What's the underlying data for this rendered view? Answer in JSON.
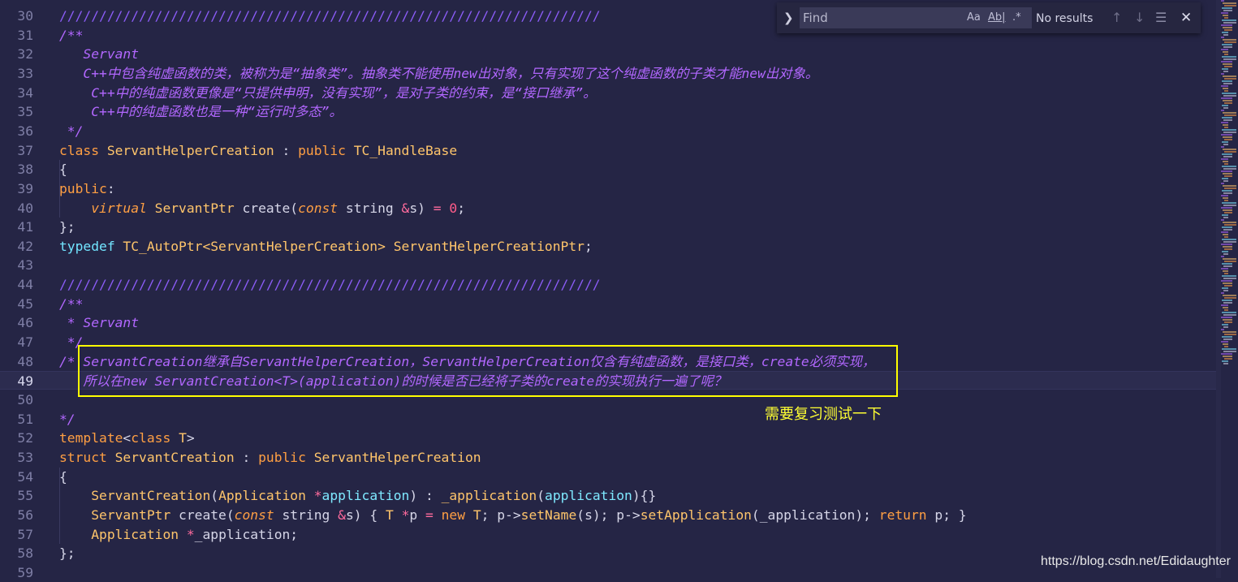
{
  "editor": {
    "lines": [
      {
        "n": "30",
        "tokens": [
          {
            "c": "t-sep",
            "t": "////////////////////////////////////////////////////////////////////"
          }
        ]
      },
      {
        "n": "31",
        "tokens": [
          {
            "c": "t-comment",
            "t": "/**"
          }
        ]
      },
      {
        "n": "32",
        "tokens": [
          {
            "c": "t-comment",
            "t": "   Servant"
          }
        ]
      },
      {
        "n": "33",
        "tokens": [
          {
            "c": "t-comment",
            "t": "   C++中包含纯虚函数的类，被称为是“抽象类”。抽象类不能使用new出对象，只有实现了这个纯虚函数的子类才能new出对象。"
          }
        ]
      },
      {
        "n": "34",
        "tokens": [
          {
            "c": "t-comment",
            "t": "    C++中的纯虚函数更像是“只提供申明，没有实现”，是对子类的约束，是“接口继承”。"
          }
        ]
      },
      {
        "n": "35",
        "tokens": [
          {
            "c": "t-comment",
            "t": "    C++中的纯虚函数也是一种“运行时多态”。"
          }
        ]
      },
      {
        "n": "36",
        "tokens": [
          {
            "c": "t-comment",
            "t": " */"
          }
        ]
      },
      {
        "n": "37",
        "tokens": [
          {
            "c": "t-kw",
            "t": "class "
          },
          {
            "c": "t-type",
            "t": "ServantHelperCreation"
          },
          {
            "c": "t-plain",
            "t": " : "
          },
          {
            "c": "t-kw",
            "t": "public "
          },
          {
            "c": "t-type",
            "t": "TC_HandleBase"
          }
        ]
      },
      {
        "n": "38",
        "tokens": [
          {
            "c": "t-plain",
            "t": "{"
          }
        ]
      },
      {
        "n": "39",
        "tokens": [
          {
            "c": "t-kw",
            "t": "public"
          },
          {
            "c": "t-plain",
            "t": ":"
          }
        ]
      },
      {
        "n": "40",
        "tokens": [
          {
            "c": "t-plain",
            "t": "    "
          },
          {
            "c": "t-italic",
            "t": "virtual "
          },
          {
            "c": "t-type",
            "t": "ServantPtr "
          },
          {
            "c": "t-plain",
            "t": "create("
          },
          {
            "c": "t-italic",
            "t": "const "
          },
          {
            "c": "t-plain",
            "t": "string "
          },
          {
            "c": "t-op",
            "t": "&"
          },
          {
            "c": "t-plain",
            "t": "s) "
          },
          {
            "c": "t-op",
            "t": "= "
          },
          {
            "c": "t-num",
            "t": "0"
          },
          {
            "c": "t-plain",
            "t": ";"
          }
        ]
      },
      {
        "n": "41",
        "tokens": [
          {
            "c": "t-plain",
            "t": "};"
          }
        ]
      },
      {
        "n": "42",
        "tokens": [
          {
            "c": "t-blue",
            "t": "typedef "
          },
          {
            "c": "t-type",
            "t": "TC_AutoPtr<ServantHelperCreation> ServantHelperCreationPtr"
          },
          {
            "c": "t-plain",
            "t": ";"
          }
        ]
      },
      {
        "n": "43",
        "tokens": []
      },
      {
        "n": "44",
        "tokens": [
          {
            "c": "t-sep",
            "t": "////////////////////////////////////////////////////////////////////"
          }
        ]
      },
      {
        "n": "45",
        "tokens": [
          {
            "c": "t-comment",
            "t": "/**"
          }
        ]
      },
      {
        "n": "46",
        "tokens": [
          {
            "c": "t-comment",
            "t": " * Servant"
          }
        ]
      },
      {
        "n": "47",
        "tokens": [
          {
            "c": "t-comment",
            "t": " */"
          }
        ]
      },
      {
        "n": "48",
        "tokens": [
          {
            "c": "t-comment",
            "t": "/* ServantCreation继承自ServantHelperCreation，ServantHelperCreation仅含有纯虚函数，是接口类，create必须实现，"
          }
        ]
      },
      {
        "n": "49",
        "current": true,
        "tokens": [
          {
            "c": "t-comment",
            "t": "   所以在new ServantCreation<T>(application)的时候是否已经将子类的create的实现执行一遍了呢？"
          }
        ]
      },
      {
        "n": "50",
        "tokens": []
      },
      {
        "n": "51",
        "tokens": [
          {
            "c": "t-comment",
            "t": "*/"
          }
        ]
      },
      {
        "n": "52",
        "tokens": [
          {
            "c": "t-kw",
            "t": "template"
          },
          {
            "c": "t-plain",
            "t": "<"
          },
          {
            "c": "t-kw",
            "t": "class "
          },
          {
            "c": "t-type",
            "t": "T"
          },
          {
            "c": "t-plain",
            "t": ">"
          }
        ]
      },
      {
        "n": "53",
        "tokens": [
          {
            "c": "t-kw",
            "t": "struct "
          },
          {
            "c": "t-type",
            "t": "ServantCreation"
          },
          {
            "c": "t-plain",
            "t": " : "
          },
          {
            "c": "t-kw",
            "t": "public "
          },
          {
            "c": "t-type",
            "t": "ServantHelperCreation"
          }
        ]
      },
      {
        "n": "54",
        "tokens": [
          {
            "c": "t-plain",
            "t": "{"
          }
        ]
      },
      {
        "n": "55",
        "tokens": [
          {
            "c": "t-plain",
            "t": "    "
          },
          {
            "c": "t-type",
            "t": "ServantCreation"
          },
          {
            "c": "t-plain",
            "t": "("
          },
          {
            "c": "t-type",
            "t": "Application "
          },
          {
            "c": "t-op",
            "t": "*"
          },
          {
            "c": "t-param",
            "t": "application"
          },
          {
            "c": "t-plain",
            "t": ") : "
          },
          {
            "c": "t-type",
            "t": "_application"
          },
          {
            "c": "t-plain",
            "t": "("
          },
          {
            "c": "t-param",
            "t": "application"
          },
          {
            "c": "t-plain",
            "t": "){}"
          }
        ]
      },
      {
        "n": "56",
        "tokens": [
          {
            "c": "t-plain",
            "t": "    "
          },
          {
            "c": "t-type",
            "t": "ServantPtr "
          },
          {
            "c": "t-plain",
            "t": "create("
          },
          {
            "c": "t-italic",
            "t": "const "
          },
          {
            "c": "t-plain",
            "t": "string "
          },
          {
            "c": "t-op",
            "t": "&"
          },
          {
            "c": "t-plain",
            "t": "s) { "
          },
          {
            "c": "t-type",
            "t": "T "
          },
          {
            "c": "t-op",
            "t": "*"
          },
          {
            "c": "t-plain",
            "t": "p "
          },
          {
            "c": "t-op",
            "t": "= "
          },
          {
            "c": "t-kw",
            "t": "new "
          },
          {
            "c": "t-type",
            "t": "T"
          },
          {
            "c": "t-plain",
            "t": "; p->"
          },
          {
            "c": "t-type",
            "t": "setName"
          },
          {
            "c": "t-plain",
            "t": "(s); p->"
          },
          {
            "c": "t-type",
            "t": "setApplication"
          },
          {
            "c": "t-plain",
            "t": "(_application); "
          },
          {
            "c": "t-kw",
            "t": "return "
          },
          {
            "c": "t-plain",
            "t": "p; }"
          }
        ]
      },
      {
        "n": "57",
        "tokens": [
          {
            "c": "t-plain",
            "t": "    "
          },
          {
            "c": "t-type",
            "t": "Application "
          },
          {
            "c": "t-op",
            "t": "*"
          },
          {
            "c": "t-plain",
            "t": "_application;"
          }
        ]
      },
      {
        "n": "58",
        "tokens": [
          {
            "c": "t-plain",
            "t": "};"
          }
        ]
      },
      {
        "n": "59",
        "tokens": []
      }
    ]
  },
  "find": {
    "placeholder": "Find",
    "match_case": "Aa",
    "whole_word": "Ab|",
    "regex": ".*",
    "status": "No results"
  },
  "annotation": {
    "note": "需要复习测试一下",
    "highlight_color": "#ffff00"
  },
  "watermark": "https://blog.csdn.net/Edidaughter"
}
